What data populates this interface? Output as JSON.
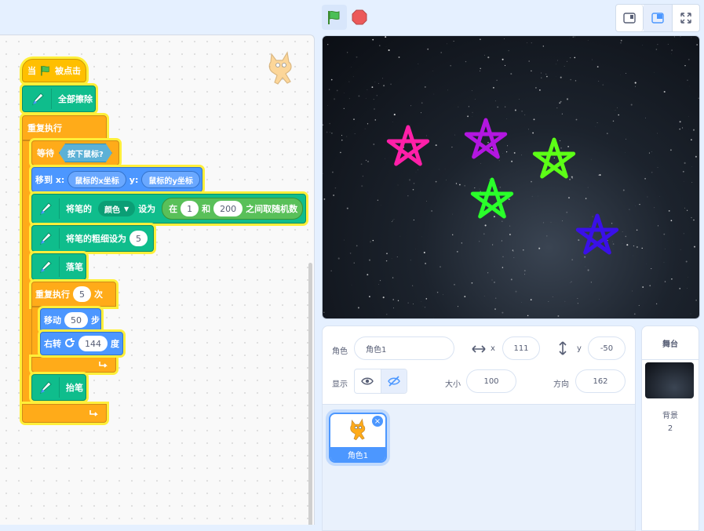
{
  "controls": {
    "green_flag_icon": "green-flag-icon",
    "stop_icon": "stop-icon"
  },
  "view_buttons": [
    "small-stage-icon",
    "normal-stage-icon",
    "fullscreen-icon"
  ],
  "script": {
    "hat": {
      "when": "当",
      "flagged": "被点击"
    },
    "clear": "全部擦除",
    "forever": "重复执行",
    "wait": {
      "label": "等待",
      "condition": "按下鼠标?"
    },
    "goto": {
      "label_x": "移到 x:",
      "x": "鼠标的x坐标",
      "label_y": "y:",
      "y": "鼠标的y坐标"
    },
    "set_color": {
      "prefix": "将笔的",
      "param": "颜色",
      "to": "设为",
      "rand_in": "在",
      "from": "1",
      "and": "和",
      "to_val": "200",
      "rand_suffix": "之间取随机数"
    },
    "set_size": {
      "label": "将笔的粗细设为",
      "value": "5"
    },
    "pen_down": "落笔",
    "repeat": {
      "label": "重复执行",
      "count": "5",
      "times": "次"
    },
    "move": {
      "label": "移动",
      "steps": "50",
      "unit": "步"
    },
    "turn": {
      "label": "右转",
      "degrees": "144",
      "unit": "度"
    },
    "pen_up": "抬笔"
  },
  "stars": [
    {
      "color": "#ff1fa8"
    },
    {
      "color": "#b316e0"
    },
    {
      "color": "#5cff16"
    },
    {
      "color": "#2aff2a"
    },
    {
      "color": "#3a10e8"
    }
  ],
  "sprite_info": {
    "sprite_label": "角色",
    "sprite_name": "角色1",
    "x_label": "x",
    "x_value": "111",
    "y_label": "y",
    "y_value": "-50",
    "show_label": "显示",
    "size_label": "大小",
    "size_value": "100",
    "direction_label": "方向",
    "direction_value": "162"
  },
  "sprite_tile": {
    "name": "角色1"
  },
  "stage_panel": {
    "title": "舞台",
    "backdrops_label": "背景",
    "backdrops_count": "2"
  }
}
